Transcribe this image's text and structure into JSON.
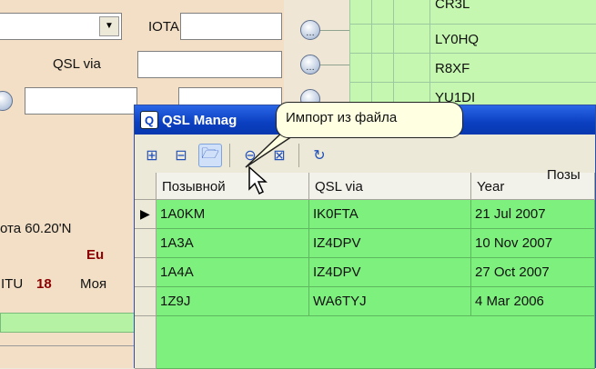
{
  "left_form": {
    "iota_label": "IOTA",
    "qsl_via_label": "QSL via",
    "lat_text": "ота 60.20'N",
    "continent": "Eu",
    "itu_label": "ITU",
    "itu_value": "18",
    "trailing_text": "Моя"
  },
  "callsign_list": [
    "CR3L",
    "LY0HQ",
    "R8XF",
    "YU1DI"
  ],
  "qsl_manager": {
    "title": "QSL Manag",
    "app_icon": "Q",
    "toolbar_buttons": [
      {
        "name": "add-record-icon",
        "glyph": "⊞"
      },
      {
        "name": "edit-record-icon",
        "glyph": "⊟"
      },
      {
        "name": "import-from-file-icon",
        "glyph": "🗁"
      },
      {
        "name": "delete-record-icon",
        "glyph": "⊖"
      },
      {
        "name": "delete-all-icon",
        "glyph": "⊠"
      },
      {
        "name": "refresh-icon",
        "glyph": "↻"
      }
    ],
    "toolbar_trailing": "Позы",
    "columns": [
      "Позывной",
      "QSL via",
      "Year"
    ],
    "rows": [
      {
        "callsign": "1A0KM",
        "qsl_via": "IK0FTA",
        "year": "21 Jul 2007"
      },
      {
        "callsign": "1A3A",
        "qsl_via": "IZ4DPV",
        "year": "10 Nov 2007"
      },
      {
        "callsign": "1A4A",
        "qsl_via": "IZ4DPV",
        "year": "27 Oct 2007"
      },
      {
        "callsign": "1Z9J",
        "qsl_via": "WA6TYJ",
        "year": "4 Mar 2006"
      }
    ],
    "current_row_marker": "▶"
  },
  "tooltip": {
    "text": "Импорт из файла"
  },
  "colors": {
    "row_green": "#7ef07e",
    "panel_green": "#c6f7b0",
    "title_blue": "#0a3fc0",
    "continent": "#8b0000"
  }
}
